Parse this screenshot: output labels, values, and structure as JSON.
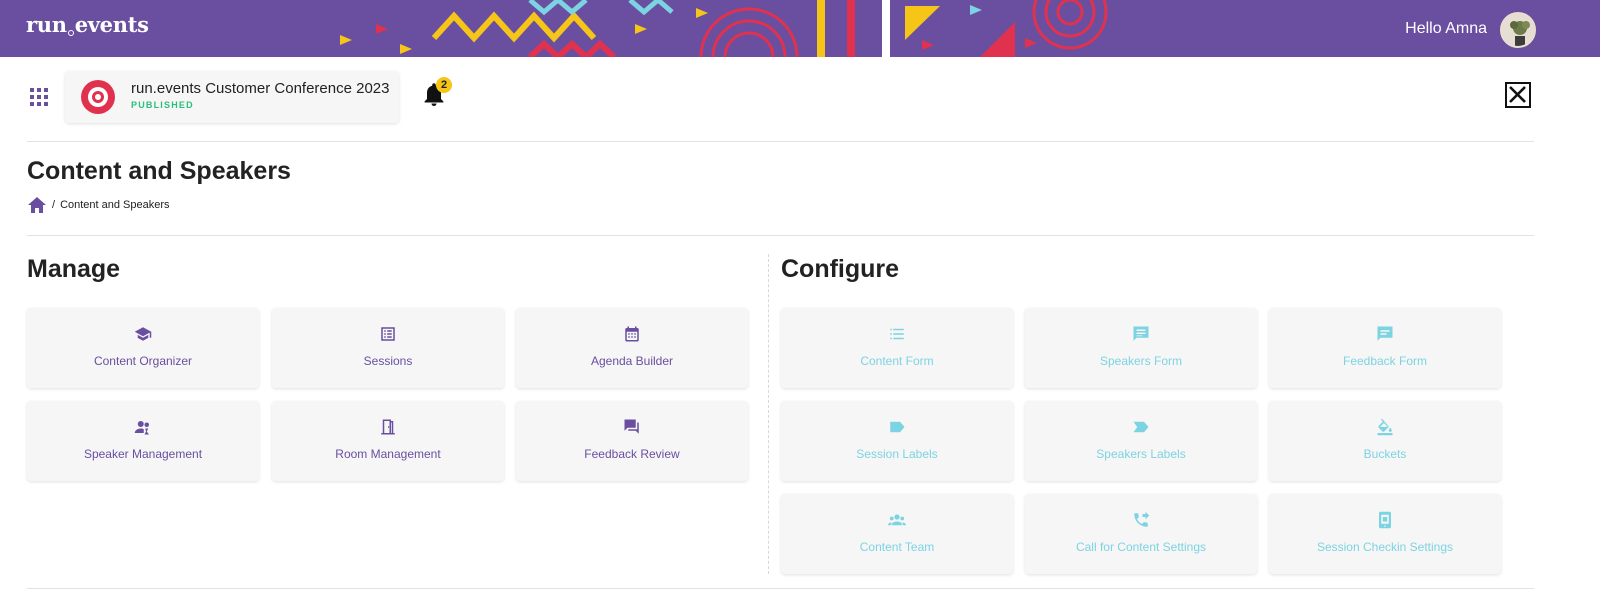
{
  "brand": {
    "logo_text_a": "run",
    "logo_text_b": "events"
  },
  "user": {
    "greeting": "Hello Amna"
  },
  "event": {
    "title": "run.events Customer Conference 2023",
    "status": "PUBLISHED",
    "notifications": "2"
  },
  "page": {
    "title": "Content and Speakers"
  },
  "breadcrumb": {
    "separator": "/",
    "current": "Content and Speakers"
  },
  "manage": {
    "title": "Manage",
    "tiles": [
      {
        "label": "Content Organizer",
        "icon": "graduation-cap-icon"
      },
      {
        "label": "Sessions",
        "icon": "list-box-icon"
      },
      {
        "label": "Agenda Builder",
        "icon": "calendar-icon"
      },
      {
        "label": "Speaker Management",
        "icon": "speaker-person-icon"
      },
      {
        "label": "Room Management",
        "icon": "door-icon"
      },
      {
        "label": "Feedback Review",
        "icon": "chat-bubbles-icon"
      }
    ]
  },
  "configure": {
    "title": "Configure",
    "tiles": [
      {
        "label": "Content Form",
        "icon": "bullet-list-icon"
      },
      {
        "label": "Speakers Form",
        "icon": "message-lines-icon"
      },
      {
        "label": "Feedback Form",
        "icon": "message-box-icon"
      },
      {
        "label": "Session Labels",
        "icon": "label-icon"
      },
      {
        "label": "Speakers Labels",
        "icon": "label-important-icon"
      },
      {
        "label": "Buckets",
        "icon": "paint-bucket-icon"
      },
      {
        "label": "Content Team",
        "icon": "group-icon"
      },
      {
        "label": "Call for Content Settings",
        "icon": "phone-forward-icon"
      },
      {
        "label": "Session Checkin Settings",
        "icon": "mobile-checkin-icon"
      }
    ]
  },
  "colors": {
    "brand_purple": "#6a4fa0",
    "configure_teal": "#7cd3e1",
    "published_green": "#2bbf7a",
    "badge_yellow": "#f5c518",
    "accent_pink": "#e0324e"
  }
}
